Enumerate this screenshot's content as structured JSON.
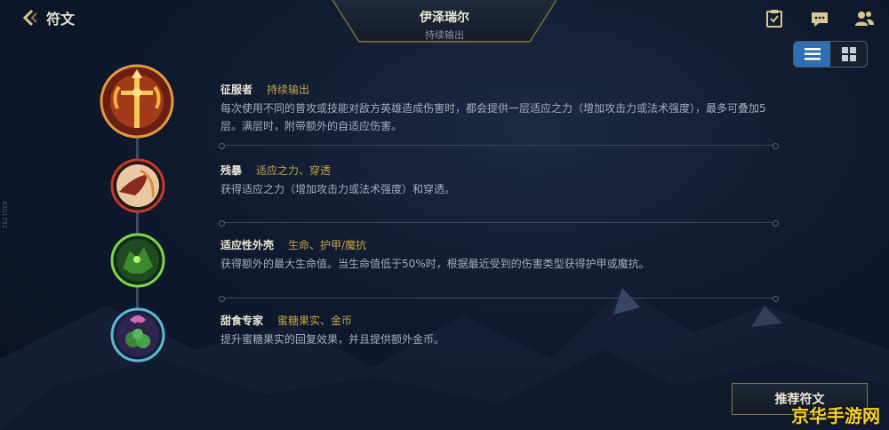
{
  "header": {
    "back_label": "符文",
    "hero_name": "伊泽瑞尔",
    "hero_role": "持续输出"
  },
  "side_id": "4201792",
  "runes": [
    {
      "name": "征服者",
      "tag": "持续输出",
      "desc": "每次使用不同的普攻或技能对敌方英雄造成伤害时，都会提供一层适应之力（增加攻击力或法术强度），最多可叠加5层。满层时，附带额外的自适应伤害。",
      "icon": "conqueror-icon"
    },
    {
      "name": "残暴",
      "tag": "适应之力、穿透",
      "desc": "获得适应之力（增加攻击力或法术强度）和穿透。",
      "icon": "brutal-icon"
    },
    {
      "name": "适应性外壳",
      "tag": "生命、护甲/魔抗",
      "desc": "获得额外的最大生命值。当生命值低于50%时，根据最近受到的伤害类型获得护甲或魔抗。",
      "icon": "adaptive-carapace-icon"
    },
    {
      "name": "甜食专家",
      "tag": "蜜糖果实、金币",
      "desc": "提升蜜糖果实的回复效果，并且提供额外金币。",
      "icon": "sweet-tooth-icon"
    }
  ],
  "recommend_label": "推荐符文",
  "watermark": "京华手游网",
  "colors": {
    "accent_gold": "#c6a349",
    "toggle_active": "#2e6fb3"
  }
}
